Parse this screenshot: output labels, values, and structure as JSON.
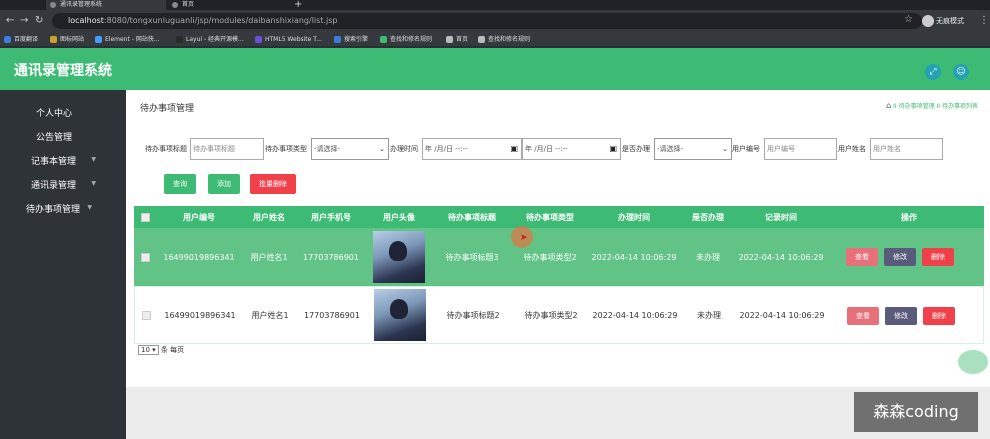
{
  "browser": {
    "tabs": [
      {
        "title": "通讯录管理系统"
      },
      {
        "title": "首页"
      }
    ],
    "url_host": "localhost",
    "url_path": ":8080/tongxunluguanli/jsp/modules/daibanshixiang/list.jsp",
    "profile_label": "无痕模式",
    "bookmarks": [
      "百度翻译",
      "图标网站",
      "Element - 网站快...",
      "Layui - 经典开源模...",
      "HTML5 Website T...",
      "搜索引擎",
      "查找和修名规则",
      "首页",
      "查找和修名规则"
    ]
  },
  "app": {
    "title": "通讯录管理系统",
    "header_icons": [
      "fullscreen-icon",
      "user-icon"
    ]
  },
  "sidebar": {
    "items": [
      {
        "label": "个人中心"
      },
      {
        "label": "公告管理"
      },
      {
        "label": "记事本管理"
      },
      {
        "label": "通讯录管理"
      },
      {
        "label": "待办事项管理"
      }
    ]
  },
  "page": {
    "title": "待办事项管理",
    "breadcrumb": [
      "待办事项管理",
      "待办事项列表"
    ]
  },
  "filters": {
    "title_label": "待办事项标题",
    "title_placeholder": "待办事项标题",
    "type_label": "待办事项类型",
    "type_select": "-请选择-",
    "time_label": "办理时间",
    "date_placeholder": "年 /月/日 --:--",
    "done_label": "是否办理",
    "done_select": "-请选择-",
    "user_no_label": "用户编号",
    "user_no_placeholder": "用户编号",
    "user_name_label": "用户姓名",
    "user_name_placeholder": "用户姓名"
  },
  "actions": {
    "search": "查询",
    "add": "添加",
    "batch_delete": "批量删除"
  },
  "table": {
    "headers": [
      "用户编号",
      "用户姓名",
      "用户手机号",
      "用户头像",
      "待办事项标题",
      "待办事项类型",
      "办理时间",
      "是否办理",
      "记录时间",
      "操作"
    ],
    "rows": [
      {
        "user_no": "16499019896341",
        "user_name": "用户姓名1",
        "phone": "17703786901",
        "title": "待办事项标题3",
        "type": "待办事项类型2",
        "time": "2022-04-14 10:06:29",
        "done": "未办理",
        "record_time": "2022-04-14 10:06:29"
      },
      {
        "user_no": "16499019896341",
        "user_name": "用户姓名1",
        "phone": "17703786901",
        "title": "待办事项标题2",
        "type": "待办事项类型2",
        "time": "2022-04-14 10:06:29",
        "done": "未办理",
        "record_time": "2022-04-14 10:06:29"
      }
    ],
    "row_actions": {
      "view": "查看",
      "edit": "修改",
      "delete": "删除"
    }
  },
  "pager": {
    "page_size": "10",
    "per_page_label": "条 每页"
  },
  "watermark": "森森coding",
  "colors": {
    "brand": "#3dbb74",
    "sidebar": "#2e3338",
    "delete": "#f0414a",
    "view": "#e8707a",
    "edit": "#5a5a7a",
    "icon_btn": "#24a1b3"
  }
}
